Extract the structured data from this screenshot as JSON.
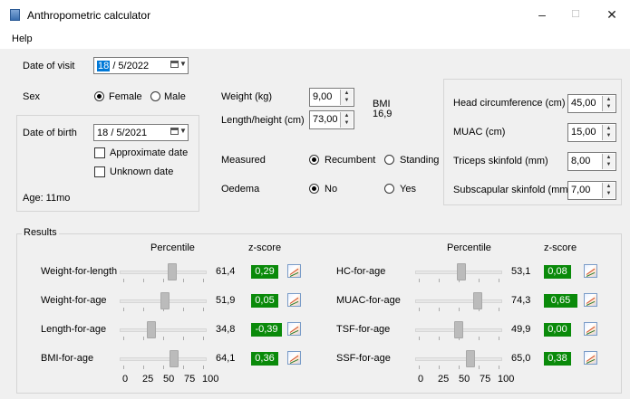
{
  "window": {
    "title": "Anthropometric calculator",
    "minimize": "–",
    "maximize": "☐",
    "close": "✕"
  },
  "menu": {
    "help": "Help"
  },
  "visit": {
    "label": "Date of visit",
    "day": "18",
    "rest": "/ 5/2022"
  },
  "sex": {
    "label": "Sex",
    "female": "Female",
    "male": "Male",
    "selected": "Female"
  },
  "birth": {
    "label": "Date of birth",
    "day": "18",
    "rest": "/ 5/2021",
    "approximate": "Approximate date",
    "unknown": "Unknown date",
    "age": "Age: 11mo"
  },
  "weight": {
    "label": "Weight (kg)",
    "value": "9,00"
  },
  "length": {
    "label": "Length/height (cm)",
    "value": "73,00"
  },
  "bmi": {
    "label": "BMI",
    "value": "16,9"
  },
  "measured": {
    "label": "Measured",
    "recumbent": "Recumbent",
    "standing": "Standing",
    "selected": "Recumbent"
  },
  "oedema": {
    "label": "Oedema",
    "no": "No",
    "yes": "Yes",
    "selected": "No"
  },
  "head": {
    "label": "Head circumference (cm)",
    "value": "45,00"
  },
  "muac": {
    "label": "MUAC (cm)",
    "value": "15,00"
  },
  "triceps": {
    "label": "Triceps skinfold (mm)",
    "value": "8,00"
  },
  "subscap": {
    "label": "Subscapular skinfold (mm)",
    "value": "7,00"
  },
  "results": {
    "title": "Results",
    "percentile_header": "Percentile",
    "zscore_header": "z-score",
    "axis": [
      "0",
      "25",
      "50",
      "75",
      "100"
    ],
    "left": [
      {
        "label": "Weight-for-length",
        "percentile": 61.4,
        "pct_text": "61,4",
        "z": "0,29"
      },
      {
        "label": "Weight-for-age",
        "percentile": 51.9,
        "pct_text": "51,9",
        "z": "0,05"
      },
      {
        "label": "Length-for-age",
        "percentile": 34.8,
        "pct_text": "34,8",
        "z": "-0,39"
      },
      {
        "label": "BMI-for-age",
        "percentile": 64.1,
        "pct_text": "64,1",
        "z": "0,36"
      }
    ],
    "right": [
      {
        "label": "HC-for-age",
        "percentile": 53.1,
        "pct_text": "53,1",
        "z": "0,08"
      },
      {
        "label": "MUAC-for-age",
        "percentile": 74.3,
        "pct_text": "74,3",
        "z": "0,65"
      },
      {
        "label": "TSF-for-age",
        "percentile": 49.9,
        "pct_text": "49,9",
        "z": "0,00"
      },
      {
        "label": "SSF-for-age",
        "percentile": 65.0,
        "pct_text": "65,0",
        "z": "0,38"
      }
    ]
  },
  "colors": {
    "zscore_bg": "#0a8a0a",
    "selection": "#0078d7"
  }
}
